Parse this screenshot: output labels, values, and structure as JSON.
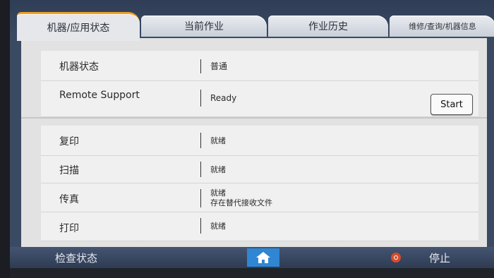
{
  "tabs": [
    {
      "label": "机器/应用状态",
      "active": true
    },
    {
      "label": "当前作业"
    },
    {
      "label": "作业历史"
    },
    {
      "label": "维修/查询/机器信息"
    }
  ],
  "top_section": [
    {
      "label": "机器状态",
      "value": "普通"
    },
    {
      "label": "Remote Support",
      "value": "Ready",
      "button": "Start"
    }
  ],
  "functions": [
    {
      "label": "复印",
      "value": "就绪"
    },
    {
      "label": "扫描",
      "value": "就绪"
    },
    {
      "label": "传真",
      "value_line1": "就绪",
      "value_line2": "存在替代接收文件"
    },
    {
      "label": "打印",
      "value": "就绪"
    }
  ],
  "bottom_bar": {
    "check_status": "检查状态",
    "home_icon": "home-icon",
    "stop_icon": "stop-icon",
    "stop_label": "停止"
  },
  "colors": {
    "accent_tab": "#f0a020",
    "home_button": "#2f86d3",
    "stop": "#d64c2c"
  }
}
